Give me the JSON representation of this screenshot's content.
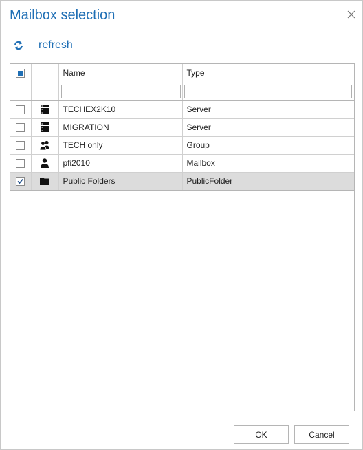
{
  "dialog": {
    "title": "Mailbox selection",
    "refresh_label": "refresh",
    "accent_color": "#1f6fb5"
  },
  "grid": {
    "columns": {
      "name": "Name",
      "type": "Type"
    },
    "filters": {
      "name_value": "",
      "type_value": ""
    },
    "select_all_state": "partial",
    "rows": [
      {
        "name": "TECHEX2K10",
        "type": "Server",
        "icon": "server-icon",
        "checked": false,
        "selected": false
      },
      {
        "name": "MIGRATION",
        "type": "Server",
        "icon": "server-icon",
        "checked": false,
        "selected": false
      },
      {
        "name": "TECH only",
        "type": "Group",
        "icon": "group-icon",
        "checked": false,
        "selected": false
      },
      {
        "name": "pfi2010",
        "type": "Mailbox",
        "icon": "user-icon",
        "checked": false,
        "selected": false
      },
      {
        "name": "Public Folders",
        "type": "PublicFolder",
        "icon": "folder-icon",
        "checked": true,
        "selected": true
      }
    ]
  },
  "buttons": {
    "ok": "OK",
    "cancel": "Cancel"
  }
}
